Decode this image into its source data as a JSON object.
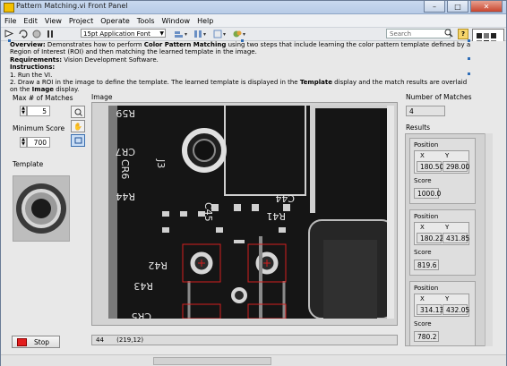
{
  "window": {
    "title": "Pattern Matching.vi Front Panel"
  },
  "menu": [
    "File",
    "Edit",
    "View",
    "Project",
    "Operate",
    "Tools",
    "Window",
    "Help"
  ],
  "toolbar": {
    "font": "15pt Application Font",
    "search_placeholder": "Search"
  },
  "description": {
    "line1_prefix": "Overview:",
    "line1_text": " Demonstrates how to perform ",
    "line1_bold": "Color Pattern Matching",
    "line1_rest": " using two steps that include learning the color pattern template defined by a Region of Interest (ROI) and then matching the learned template in the image.",
    "req_label": "Requirements:",
    "req_text": " Vision Development Software.",
    "instr_label": "Instructions:",
    "step1": "1. Run the VI.",
    "step2_a": "2. Draw a ROI in the image to define the template. The learned template is displayed in the ",
    "step2_b1": "Template",
    "step2_c": " display and the match results are overlaid on the ",
    "step2_b2": "Image",
    "step2_d": " display."
  },
  "controls": {
    "max_matches_label": "Max # of Matches",
    "max_matches_value": "5",
    "min_score_label": "Minimum Score",
    "min_score_value": "700",
    "template_label": "Template",
    "image_label": "Image",
    "num_matches_label": "Number of Matches",
    "num_matches_value": "4",
    "results_label": "Results",
    "stop_label": "Stop",
    "status_left": "44",
    "status_coord": "(219,12)"
  },
  "results": [
    {
      "position_label": "Position",
      "x_label": "X",
      "y_label": "Y",
      "x": "180.50",
      "y": "298.00",
      "score_label": "Score",
      "score": "1000.0"
    },
    {
      "position_label": "Position",
      "x_label": "X",
      "y_label": "Y",
      "x": "180.22",
      "y": "431.85",
      "score_label": "Score",
      "score": "819.6"
    },
    {
      "position_label": "Position",
      "x_label": "X",
      "y_label": "Y",
      "x": "314.13",
      "y": "432.05",
      "score_label": "Score",
      "score": "780.2"
    }
  ],
  "pcb_labels": [
    "R59",
    "CR7",
    "J3",
    "CR6",
    "R44",
    "C45",
    "C44",
    "R41",
    "R42",
    "R43",
    "CR5"
  ],
  "colors": {
    "title_bg": "#c9d9ef",
    "stop_led": "#e21e1e",
    "match_box": "#d21f1f"
  }
}
